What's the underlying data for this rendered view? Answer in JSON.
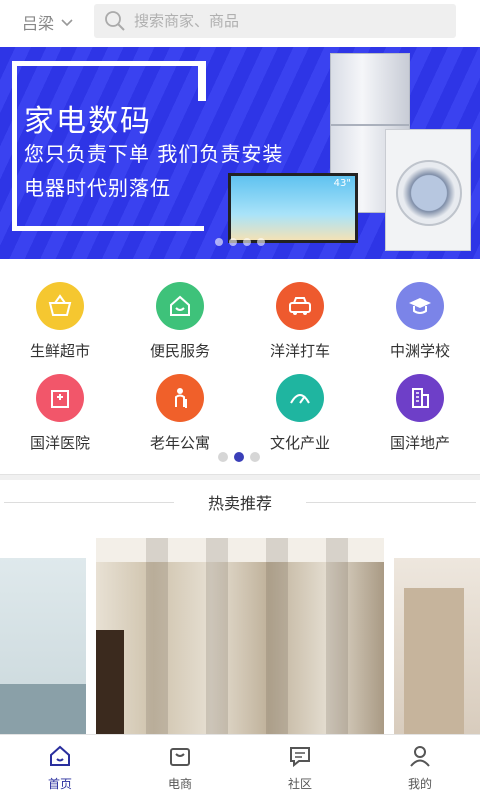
{
  "header": {
    "city": "吕梁",
    "search_placeholder": "搜索商家、商品"
  },
  "banner": {
    "title": "家电数码",
    "line2": "您只负责下单  我们负责安装",
    "line3": "电器时代别落伍",
    "tv_size": "43\"",
    "slide_count": 4,
    "active_slide": 0
  },
  "categories": [
    {
      "label": "生鲜超市",
      "color": "#f5c730",
      "icon": "basket-icon"
    },
    {
      "label": "便民服务",
      "color": "#3ec27a",
      "icon": "house-icon"
    },
    {
      "label": "洋洋打车",
      "color": "#ee5a2e",
      "icon": "taxi-icon"
    },
    {
      "label": "中渊学校",
      "color": "#7b84e8",
      "icon": "graduation-cap-icon"
    },
    {
      "label": "国洋医院",
      "color": "#f2566a",
      "icon": "hospital-icon"
    },
    {
      "label": "老年公寓",
      "color": "#f0602a",
      "icon": "elder-icon"
    },
    {
      "label": "文化产业",
      "color": "#1fb5a0",
      "icon": "culture-icon"
    },
    {
      "label": "国洋地产",
      "color": "#6e3fc8",
      "icon": "building-icon"
    }
  ],
  "category_pager": {
    "pages": 3,
    "active": 1
  },
  "section": {
    "hot_title": "热卖推荐"
  },
  "nav": [
    {
      "label": "首页",
      "icon": "home-icon",
      "active": true
    },
    {
      "label": "电商",
      "icon": "shop-bag-icon",
      "active": false
    },
    {
      "label": "社区",
      "icon": "chat-icon",
      "active": false
    },
    {
      "label": "我的",
      "icon": "user-icon",
      "active": false
    }
  ],
  "colors": {
    "accent": "#2a2f9e",
    "banner_blue": "#2e35e6"
  }
}
